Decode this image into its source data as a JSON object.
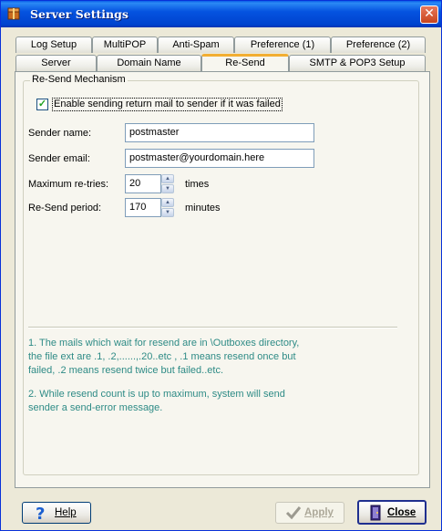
{
  "window": {
    "title": "Server Settings"
  },
  "tabs_row1": [
    "Log Setup",
    "MultiPOP",
    "Anti-Spam",
    "Preference (1)",
    "Preference (2)"
  ],
  "tabs_row2": [
    "Server",
    "Domain Name",
    "Re-Send",
    "SMTP & POP3 Setup"
  ],
  "active_tab": "Re-Send",
  "group": {
    "title": "Re-Send Mechanism",
    "enable_checkbox": {
      "label": "Enable sending return mail to sender if it was failed",
      "checked": true
    },
    "sender_name": {
      "label": "Sender name:",
      "value": "postmaster"
    },
    "sender_email": {
      "label": "Sender email:",
      "value": "postmaster@yourdomain.here"
    },
    "max_retries": {
      "label": "Maximum re-tries:",
      "value": "20",
      "unit": "times"
    },
    "resend_period": {
      "label": "Re-Send period:",
      "value": "170",
      "unit": "minutes"
    },
    "note1": [
      "1. The mails which wait for resend are in \\Outboxes  directory,",
      "the file ext are .1, .2,......,.20..etc , .1 means resend once but",
      "failed, .2 means resend twice but failed..etc."
    ],
    "note2": [
      "2. While resend count is up to maximum, system will send",
      "sender a send-error message."
    ]
  },
  "buttons": {
    "help": "Help",
    "apply": "Apply",
    "close": "Close"
  },
  "colors": {
    "titlebar": "#0054E3",
    "note_text": "#2E8B86",
    "active_tab_accent": "#F2AE31"
  }
}
